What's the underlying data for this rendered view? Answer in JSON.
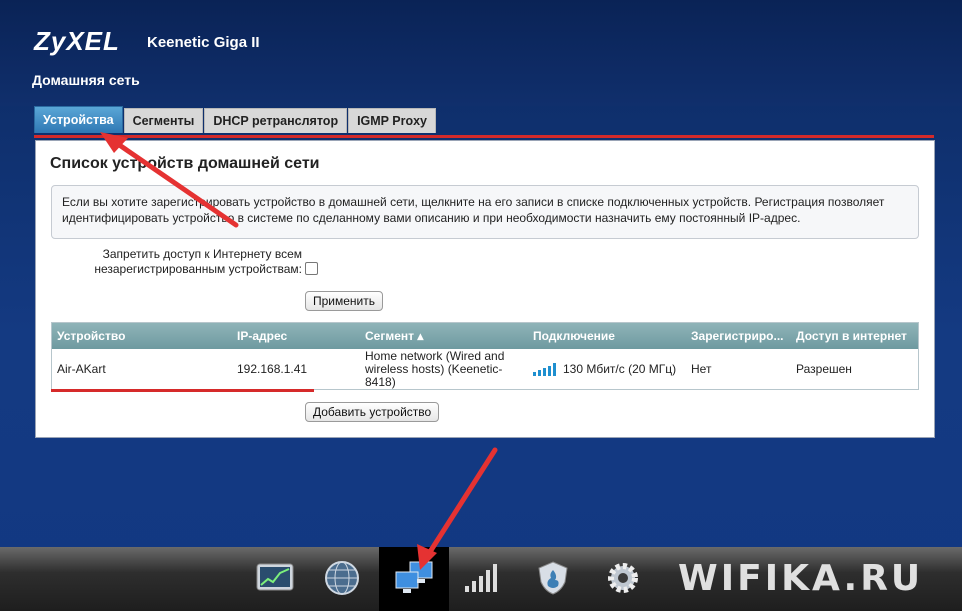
{
  "header": {
    "brand": "ZyXEL",
    "model": "Keenetic Giga II",
    "section": "Домашняя сеть"
  },
  "tabs": [
    {
      "label": "Устройства",
      "active": true
    },
    {
      "label": "Сегменты",
      "active": false
    },
    {
      "label": "DHCP ретранслятор",
      "active": false
    },
    {
      "label": "IGMP Proxy",
      "active": false
    }
  ],
  "panel": {
    "title": "Список устройств домашней сети",
    "info": "Если вы хотите зарегистрировать устройство в домашней сети, щелкните на его записи в списке подключенных устройств. Регистрация позволяет идентифицировать устройство в системе по сделанному вами описанию и при необходимости назначить ему постоянный IP-адрес.",
    "block_label": "Запретить доступ к Интернету всем незарегистрированным устройствам:",
    "block_checked": false,
    "apply_label": "Применить",
    "add_label": "Добавить устройство"
  },
  "table": {
    "headers": [
      "Устройство",
      "IP-адрес",
      "Сегмент ▴",
      "Подключение",
      "Зарегистриро...",
      "Доступ в интернет"
    ],
    "rows": [
      {
        "device": "Air-AKart",
        "ip": "192.168.1.41",
        "segment": "Home network (Wired and wireless hosts) (Keenetic-8418)",
        "connection": "130 Мбит/с (20 МГц)",
        "registered": "Нет",
        "access": "Разрешен"
      }
    ]
  },
  "taskbar": {
    "icons": [
      "monitor-graph-icon",
      "globe-icon",
      "home-network-icon",
      "signal-bars-icon",
      "shield-flame-icon",
      "gear-icon"
    ],
    "active": "home-network-icon",
    "watermark": "WIFIKA.RU"
  },
  "colors": {
    "background": "#143a82",
    "tab_active": "#2f78b4",
    "table_header": "#7aa5ab",
    "annotation_red": "#d62a2a",
    "signal": "#1e8fcf"
  }
}
